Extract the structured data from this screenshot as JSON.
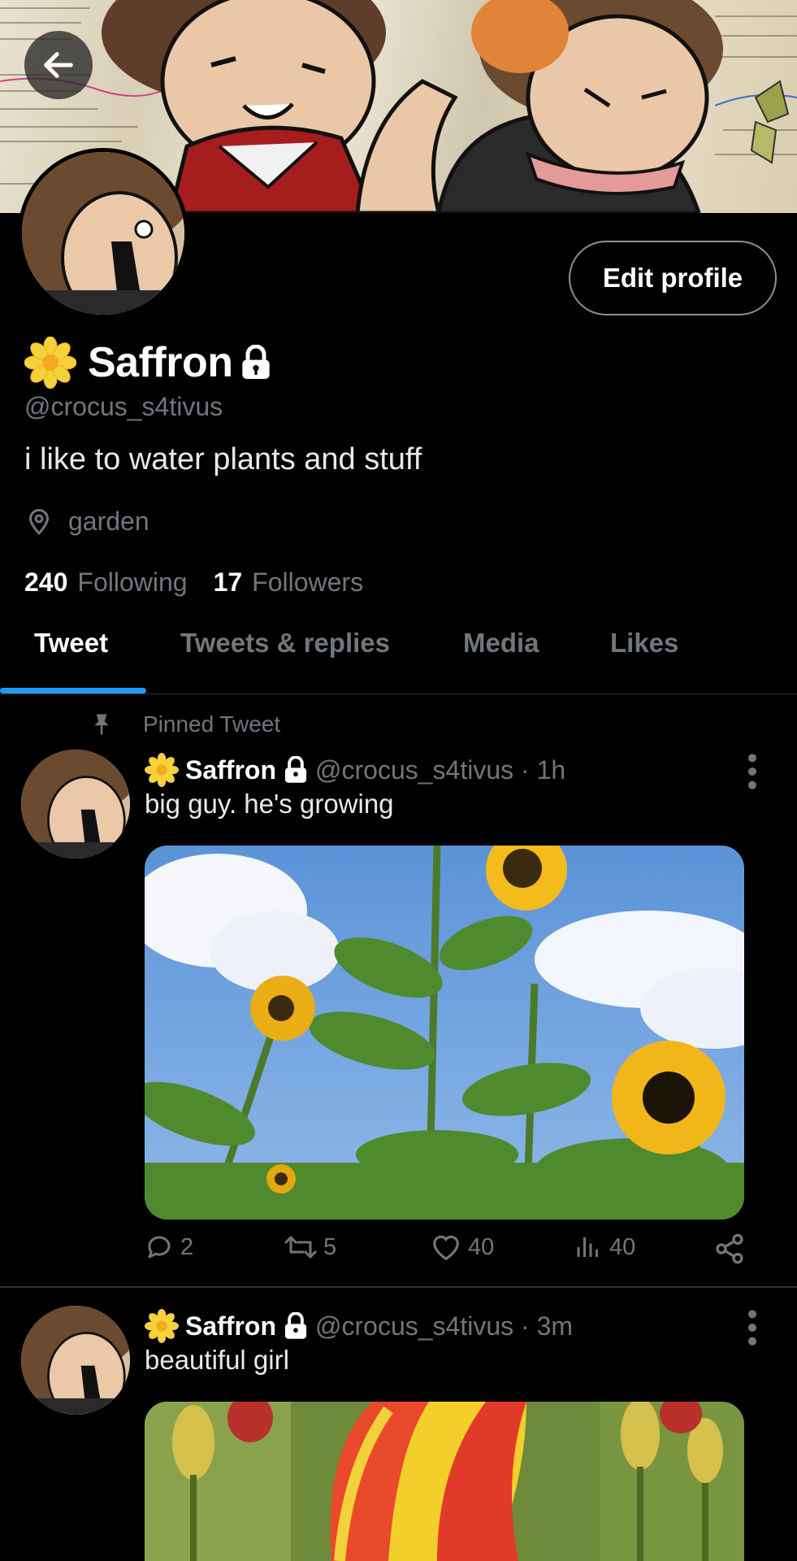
{
  "profile": {
    "display_name": "Saffron",
    "handle": "@crocus_s4tivus",
    "bio": "i like to water plants and stuff",
    "location": "garden",
    "following_count": "240",
    "following_label": "Following",
    "followers_count": "17",
    "followers_label": "Followers",
    "edit_label": "Edit profile"
  },
  "tabs": [
    {
      "label": "Tweet",
      "active": true
    },
    {
      "label": "Tweets & replies",
      "active": false
    },
    {
      "label": "Media",
      "active": false
    },
    {
      "label": "Likes",
      "active": false
    }
  ],
  "pinned_label": "Pinned Tweet",
  "tweets": [
    {
      "name": "Saffron",
      "handle": "@crocus_s4tivus",
      "time": "1h",
      "text": "big guy. he's growing",
      "media": "sunflowers photo",
      "replies": "2",
      "retweets": "5",
      "likes": "40",
      "views": "40"
    },
    {
      "name": "Saffron",
      "handle": "@crocus_s4tivus",
      "time": "3m",
      "text": "beautiful girl",
      "media": "tulips photo"
    }
  ],
  "icons": [
    "back-arrow-icon",
    "lock-icon",
    "location-pin-icon",
    "pin-icon",
    "reply-icon",
    "retweet-icon",
    "like-icon",
    "views-icon",
    "share-icon",
    "more-icon"
  ],
  "colors": {
    "accent": "#1d9bf0",
    "background": "#000000",
    "muted": "#71767b"
  }
}
